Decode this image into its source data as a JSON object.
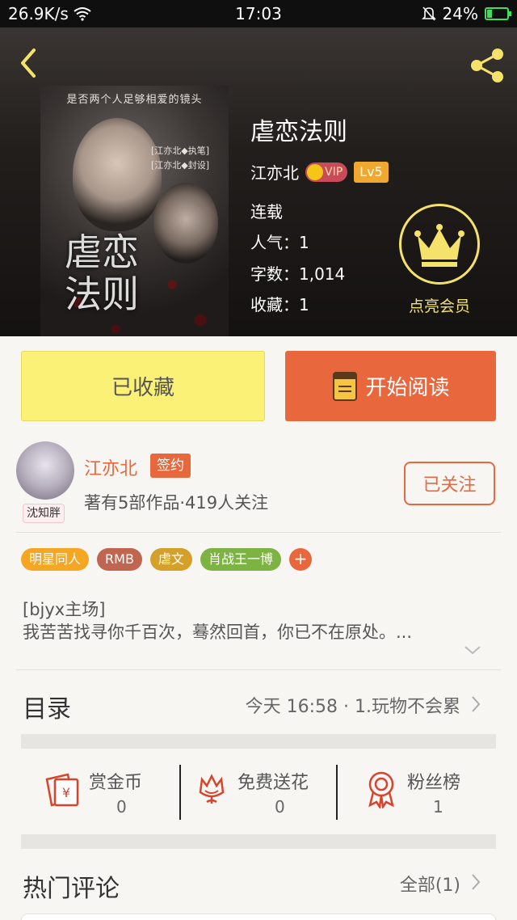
{
  "status_bar": {
    "speed": "26.9K/s",
    "time": "17:03",
    "battery": "24%",
    "battery_level": 0.24
  },
  "book": {
    "title": "虐恋法则",
    "author": "江亦北",
    "vip_label": "VIP",
    "level": "Lv5",
    "status": "连载",
    "popularity_label": "人气：",
    "popularity": "1",
    "words_label": "字数：",
    "words": "1,014",
    "favorites_label": "收藏：",
    "favorites": "1",
    "cover": {
      "banner": "是否两个人足够相爱的镜头",
      "credit1": "[江亦北◆执笔]",
      "credit2": "[江亦北◆封设]",
      "art_title": "虐恋法则"
    }
  },
  "membership": {
    "label": "点亮会员"
  },
  "actions": {
    "collect_label": "已收藏",
    "read_label": "开始阅读"
  },
  "author_card": {
    "name": "江亦北",
    "signed_badge": "签约",
    "meta": "著有5部作品·419人关注",
    "follow_label": "已关注",
    "avatar_tag": "沈知胖"
  },
  "tags": [
    {
      "label": "明星同人",
      "color": "#f5a623"
    },
    {
      "label": "RMB",
      "color": "#c0654f"
    },
    {
      "label": "虐文",
      "color": "#d4a02a"
    },
    {
      "label": "肖战王一博",
      "color": "#7cb342"
    }
  ],
  "tag_add_label": "+",
  "description": {
    "line1": "[bjyx主场]",
    "line2": "我苦苦找寻你千百次，蓦然回首，你已不在原处。..."
  },
  "toc": {
    "label": "目录",
    "latest": "今天 16:58 · 1.玩物不会累"
  },
  "stats": [
    {
      "label": "赏金币",
      "value": "0",
      "icon": "red-envelope-icon"
    },
    {
      "label": "免费送花",
      "value": "0",
      "icon": "flower-icon"
    },
    {
      "label": "粉丝榜",
      "value": "1",
      "icon": "medal-icon"
    }
  ],
  "comments": {
    "label": "热门评论",
    "all_label": "全部(1)"
  },
  "colors": {
    "accent": "#e8673d",
    "collect_bg": "#fbf176",
    "vip_gold": "#f4e26a"
  }
}
